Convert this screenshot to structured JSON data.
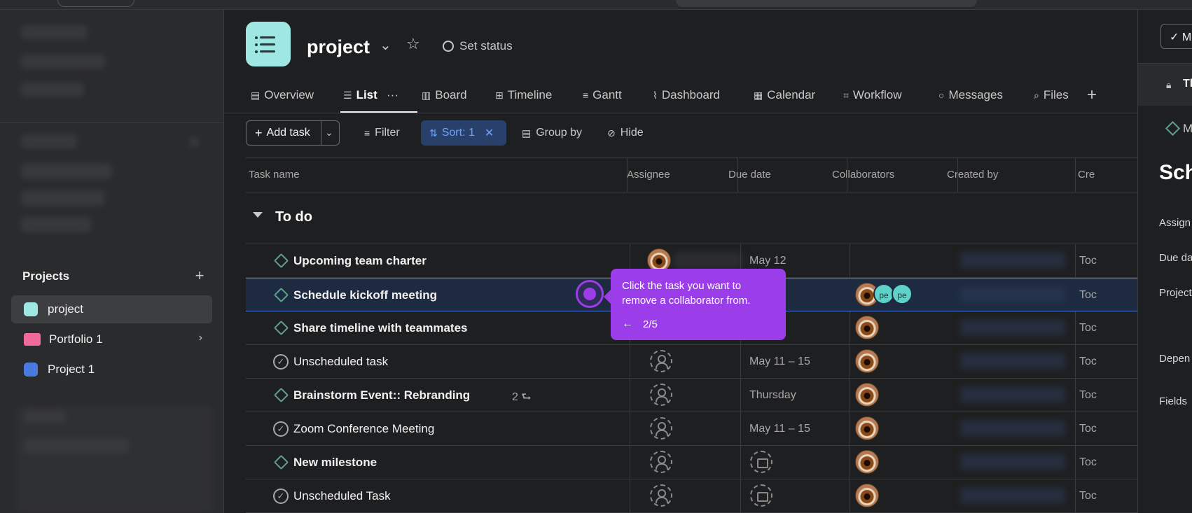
{
  "sidebar": {
    "projects_heading": "Projects",
    "projects_add": "+",
    "items": [
      {
        "label": "project",
        "color": "#9ee7e3"
      },
      {
        "label": "Portfolio 1",
        "color": "#f06a9c"
      },
      {
        "label": "Project 1",
        "color": "#4a7ae0"
      }
    ]
  },
  "header": {
    "title": "project",
    "chevron": "⌄",
    "star": "☆",
    "set_status": "Set status"
  },
  "tabs": [
    {
      "label": "Overview",
      "icon": "▤"
    },
    {
      "label": "List",
      "icon": "☰"
    },
    {
      "label": "···",
      "icon": ""
    },
    {
      "label": "Board",
      "icon": "▥"
    },
    {
      "label": "Timeline",
      "icon": "⊞"
    },
    {
      "label": "Gantt",
      "icon": "≡"
    },
    {
      "label": "Dashboard",
      "icon": "⌇"
    },
    {
      "label": "Calendar",
      "icon": "▦"
    },
    {
      "label": "Workflow",
      "icon": "⌗"
    },
    {
      "label": "Messages",
      "icon": "○"
    },
    {
      "label": "Files",
      "icon": "⌕"
    },
    {
      "label": "+",
      "icon": ""
    }
  ],
  "toolbar": {
    "add_task": "Add task",
    "filter": "Filter",
    "sort": "Sort: 1",
    "group_by": "Group by",
    "hide": "Hide"
  },
  "table": {
    "columns": [
      "Task name",
      "Assignee",
      "Due date",
      "Collaborators",
      "Created by",
      "Cre"
    ],
    "section": "To do",
    "rows": [
      {
        "name": "Upcoming team charter",
        "due": "May 12",
        "created": "Toc"
      },
      {
        "name": "Schedule kickoff meeting",
        "due": "",
        "created": "Toc",
        "collab_initials": [
          "pe",
          "pe"
        ]
      },
      {
        "name": "Share timeline with teammates",
        "due": "",
        "created": "Toc"
      },
      {
        "name": "Unscheduled task",
        "due": "May 11 – 15",
        "created": "Toc"
      },
      {
        "name": "Brainstorm Event:: Rebranding",
        "due": "Thursday",
        "created": "Toc",
        "subtasks": "2 ⮑"
      },
      {
        "name": "Zoom Conference Meeting",
        "due": "May 11 – 15",
        "created": "Toc"
      },
      {
        "name": "New milestone",
        "due": "",
        "created": "Toc"
      },
      {
        "name": "Unscheduled Task",
        "due": "",
        "created": "Toc"
      }
    ]
  },
  "tooltip": {
    "text": "Click the task you want to remove a collaborator from.",
    "arrow": "←",
    "step": "2/5"
  },
  "right_panel": {
    "button": "✓ M",
    "lock_text": "Th",
    "milestone": "M",
    "title": "Sch",
    "labels": [
      "Assign",
      "Due da",
      "Project",
      "Depen",
      "Fields"
    ]
  },
  "colors": {
    "accent_purple": "#9b3de8",
    "sort_blue": "#6fa2ff",
    "milestone_green": "#5aa18f"
  }
}
